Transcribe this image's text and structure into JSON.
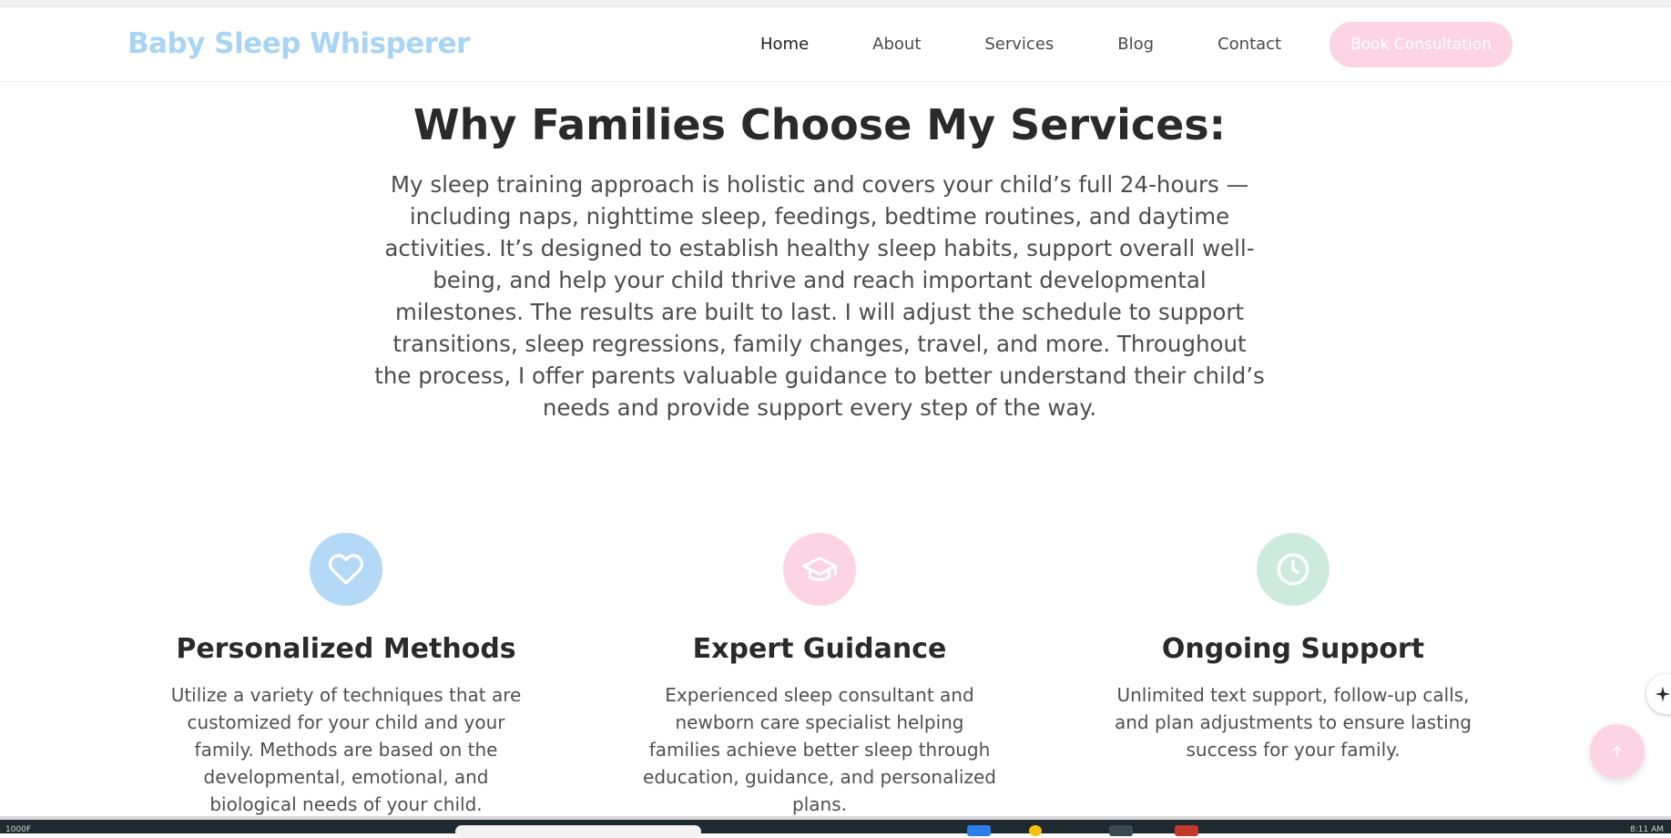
{
  "header": {
    "logo": "Baby Sleep Whisperer",
    "nav": [
      "Home",
      "About",
      "Services",
      "Blog",
      "Contact"
    ],
    "active_nav": "Home",
    "cta_label": "Book Consultation"
  },
  "section": {
    "title": "Why Families Choose My Services:",
    "intro": "My sleep training approach is holistic and covers your child’s full 24-hours — including naps, nighttime sleep, feedings, bedtime routines, and daytime activities. It’s designed to establish healthy sleep habits, support overall well-being, and help your child thrive and reach important developmental milestones. The results are built to last. I will adjust the schedule to support transitions, sleep regressions, family changes, travel, and more. Throughout the process, I offer parents valuable guidance to better understand their child’s needs and provide support every step of the way."
  },
  "features": [
    {
      "icon": "heart-icon",
      "color": "#b3d9f7",
      "title": "Personalized Methods",
      "text": "Utilize a variety of techniques that are customized for your child and your family. Methods are based on the developmental, emotional, and biological needs of your child."
    },
    {
      "icon": "graduation-cap-icon",
      "color": "#fcd4e3",
      "title": "Expert Guidance",
      "text": "Experienced sleep consultant and newborn care specialist helping families achieve better sleep through education, guidance, and personalized plans."
    },
    {
      "icon": "clock-icon",
      "color": "#cdebdc",
      "title": "Ongoing Support",
      "text": "Unlimited text support, follow-up calls, and plan adjustments to ensure lasting success for your family."
    }
  ],
  "colors": {
    "logo": "#a8d4f5",
    "cta": "#fcd4e3",
    "scroll_top": "#fcd4e3"
  },
  "taskbar": {
    "left_text": "1000F",
    "right_text": "8:11 AM"
  }
}
